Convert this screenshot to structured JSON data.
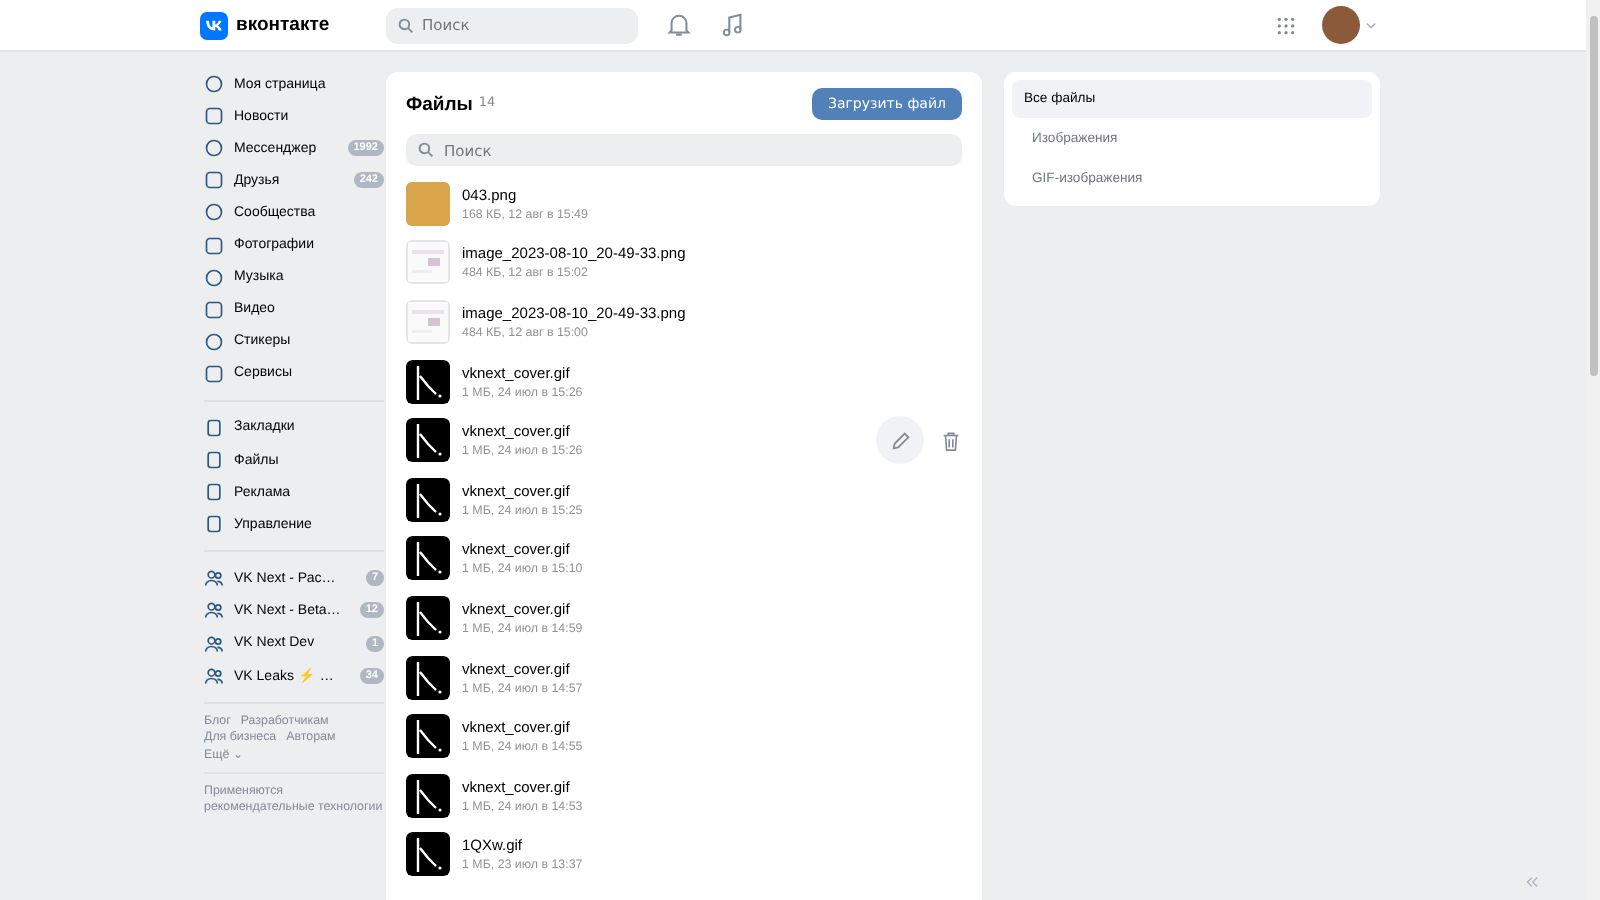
{
  "header": {
    "logo_text": "вконтакте",
    "search": {
      "placeholder": "Поиск"
    }
  },
  "sidebar": {
    "items": [
      {
        "label": "Моя страница"
      },
      {
        "label": "Новости"
      },
      {
        "label": "Мессенджер",
        "badge": "1992"
      },
      {
        "label": "Друзья",
        "badge": "242"
      },
      {
        "label": "Сообщества"
      },
      {
        "label": "Фотографии"
      },
      {
        "label": "Музыка"
      },
      {
        "label": "Видео"
      },
      {
        "label": "Стикеры"
      },
      {
        "label": "Сервисы"
      }
    ],
    "items_2": [
      {
        "label": "Закладки"
      },
      {
        "label": "Файлы"
      },
      {
        "label": "Реклама"
      },
      {
        "label": "Управление"
      }
    ],
    "groups": [
      {
        "label": "VK Next - Рас…",
        "badge": "7"
      },
      {
        "label": "VK Next - Beta…",
        "badge": "12"
      },
      {
        "label": "VK Next Dev",
        "badge": "1"
      },
      {
        "label": "VK Leaks ⚡ …",
        "badge": "34"
      }
    ],
    "footer_links": [
      "Блог",
      "Разработчикам",
      "Для бизнеса",
      "Авторам",
      "Ещё ⌄"
    ],
    "notice": "Применяются рекомендательные технологии"
  },
  "files": {
    "title": "Файлы",
    "count": "14",
    "upload_button": "Загрузить файл",
    "search": {
      "placeholder": "Поиск"
    },
    "items": [
      {
        "kind": "photo",
        "name": "043.png",
        "meta": "168 КБ, 12 авг в 15:49",
        "hovered": false
      },
      {
        "kind": "screenshot",
        "name": "image_2023-08-10_20-49-33.png",
        "meta": "484 КБ, 12 авг в 15:02",
        "hovered": false
      },
      {
        "kind": "screenshot",
        "name": "image_2023-08-10_20-49-33.png",
        "meta": "484 КБ, 12 авг в 15:00",
        "hovered": false
      },
      {
        "kind": "cover",
        "name": "vknext_cover.gif",
        "meta": "1 МБ, 24 июл в 15:26",
        "hovered": false
      },
      {
        "kind": "cover",
        "name": "vknext_cover.gif",
        "meta": "1 МБ, 24 июл в 15:26",
        "hovered": true
      },
      {
        "kind": "cover",
        "name": "vknext_cover.gif",
        "meta": "1 МБ, 24 июл в 15:25",
        "hovered": false
      },
      {
        "kind": "cover",
        "name": "vknext_cover.gif",
        "meta": "1 МБ, 24 июл в 15:10",
        "hovered": false
      },
      {
        "kind": "cover",
        "name": "vknext_cover.gif",
        "meta": "1 МБ, 24 июл в 14:59",
        "hovered": false
      },
      {
        "kind": "cover",
        "name": "vknext_cover.gif",
        "meta": "1 МБ, 24 июл в 14:57",
        "hovered": false
      },
      {
        "kind": "cover",
        "name": "vknext_cover.gif",
        "meta": "1 МБ, 24 июл в 14:55",
        "hovered": false
      },
      {
        "kind": "cover",
        "name": "vknext_cover.gif",
        "meta": "1 МБ, 24 июл в 14:53",
        "hovered": false
      },
      {
        "kind": "cover",
        "name": "1QXw.gif",
        "meta": "1 МБ, 23 июл в 13:37",
        "hovered": false
      }
    ]
  },
  "filters": [
    {
      "label": "Все файлы",
      "selected": true
    },
    {
      "label": "Изображения",
      "selected": false
    },
    {
      "label": "GIF-изображения",
      "selected": false
    }
  ]
}
